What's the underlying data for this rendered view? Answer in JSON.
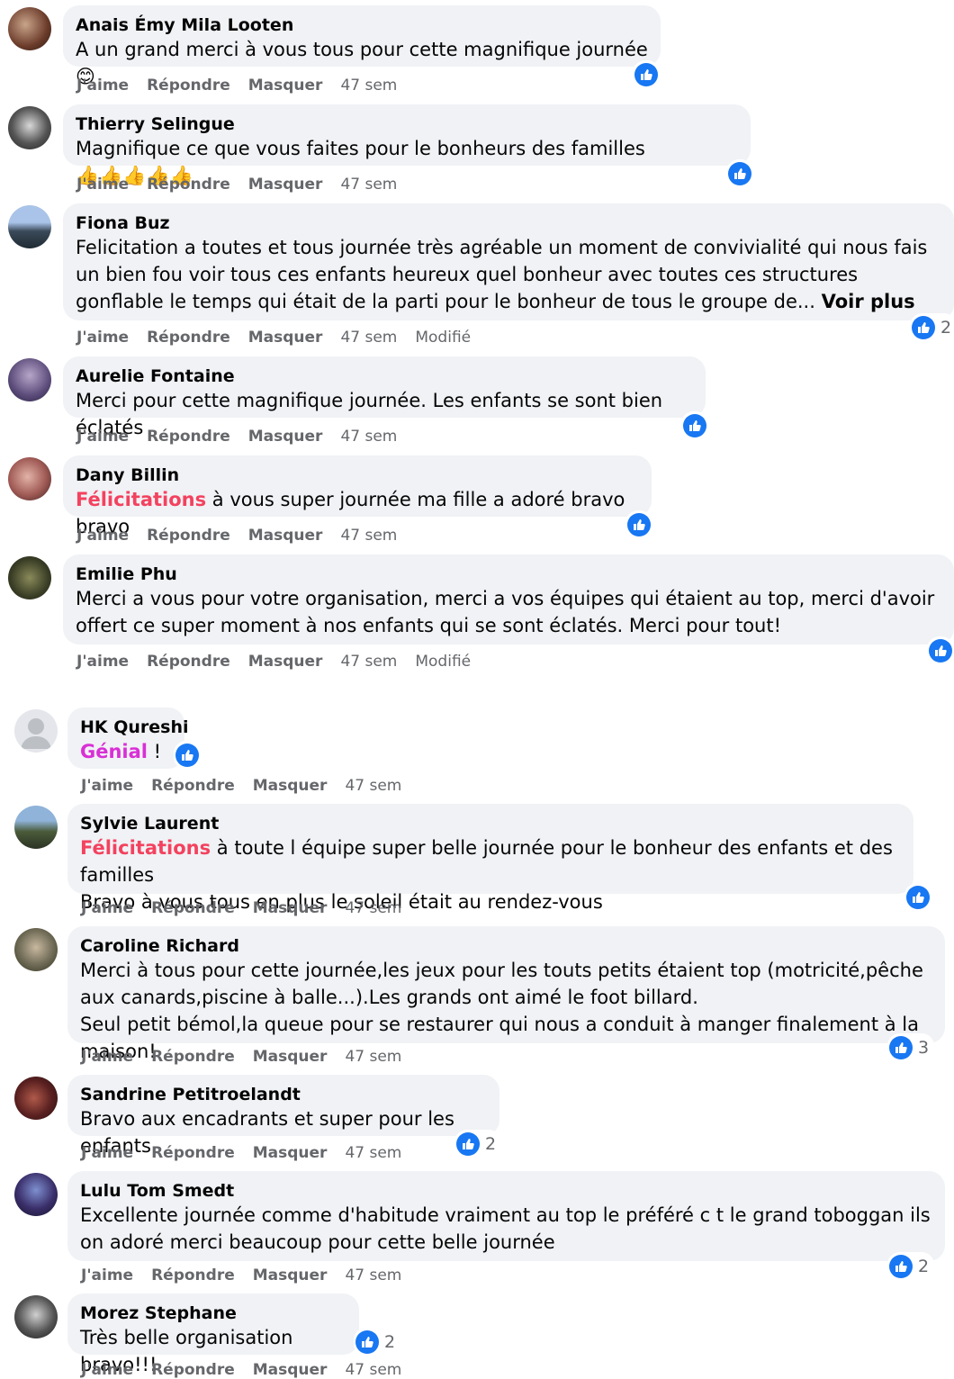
{
  "actions": {
    "like": "J'aime",
    "reply": "Répondre",
    "hide": "Masquer",
    "edited": "Modifié"
  },
  "comments": [
    {
      "name": "Anais Émy Mila Looten",
      "text": "A un grand merci à vous tous pour cette magnifique journée",
      "emoji": "😊",
      "time": "47 sem"
    },
    {
      "name": "Thierry Selingue",
      "text": "Magnifique ce que vous faites pour le bonheurs des familles",
      "emoji": "👍👍👍👍👍",
      "time": "47 sem"
    },
    {
      "name": "Fiona Buz",
      "text": "Felicitation a toutes et tous journée très agréable un moment de convivialité qui nous fais un bien fou voir tous ces enfants heureux quel bonheur avec toutes ces structures gonflable le temps qui était de la parti pour le bonheur de tous le groupe de...",
      "see_more": "Voir plus",
      "time": "47 sem",
      "edited": true,
      "reactions": "2"
    },
    {
      "name": "Aurelie Fontaine",
      "text": "Merci pour cette magnifique journée. Les enfants se sont bien éclatés",
      "time": "47 sem"
    },
    {
      "name": "Dany Billin",
      "highlight": "Félicitations",
      "text": " à vous super journée ma fille a adoré bravo bravo",
      "time": "47 sem"
    },
    {
      "name": "Emilie Phu",
      "text": "Merci a vous pour votre organisation, merci a vos équipes qui étaient au top, merci d'avoir offert ce super moment à nos enfants qui se sont éclatés. Merci pour tout!",
      "time": "47 sem",
      "edited": true
    },
    {
      "name": "HK Qureshi",
      "highlight": "Génial",
      "text": " !",
      "time": "47 sem"
    },
    {
      "name": "Sylvie Laurent",
      "highlight": "Félicitations",
      "text": " à toute l équipe super belle journée pour le bonheur des enfants et des familles",
      "text2": "Bravo à vous tous en plus le soleil était au rendez-vous",
      "time": "47 sem"
    },
    {
      "name": "Caroline Richard",
      "text": "Merci à tous pour cette journée,les jeux pour les touts petits étaient top (motricité,pêche aux canards,piscine à balle...).Les grands ont aimé le foot billard.",
      "text2": "Seul petit bémol,la queue pour se restaurer qui nous a conduit à manger finalement à la maison!",
      "time": "47 sem",
      "reactions": "3"
    },
    {
      "name": "Sandrine Petitroelandt",
      "text": "Bravo aux encadrants et super pour les enfants",
      "time": "47 sem",
      "reactions": "2"
    },
    {
      "name": "Lulu Tom Smedt",
      "text": "Excellente journée comme d'habitude vraiment au top le préféré c t le grand toboggan ils on adoré merci beaucoup pour cette belle journée",
      "time": "47 sem",
      "reactions": "2"
    },
    {
      "name": "Morez Stephane",
      "text": "Très belle organisation bravo!!!",
      "time": "47 sem",
      "reactions": "2"
    }
  ],
  "colors": {
    "like_blue": "#1877f2",
    "bubble_bg": "#f0f2f5",
    "secondary_text": "#65676b",
    "highlight_red": "#f3425f",
    "highlight_pink": "#d92fd6"
  },
  "icons": {
    "reaction": "like-thumb-icon",
    "avatar": "profile-avatar"
  }
}
